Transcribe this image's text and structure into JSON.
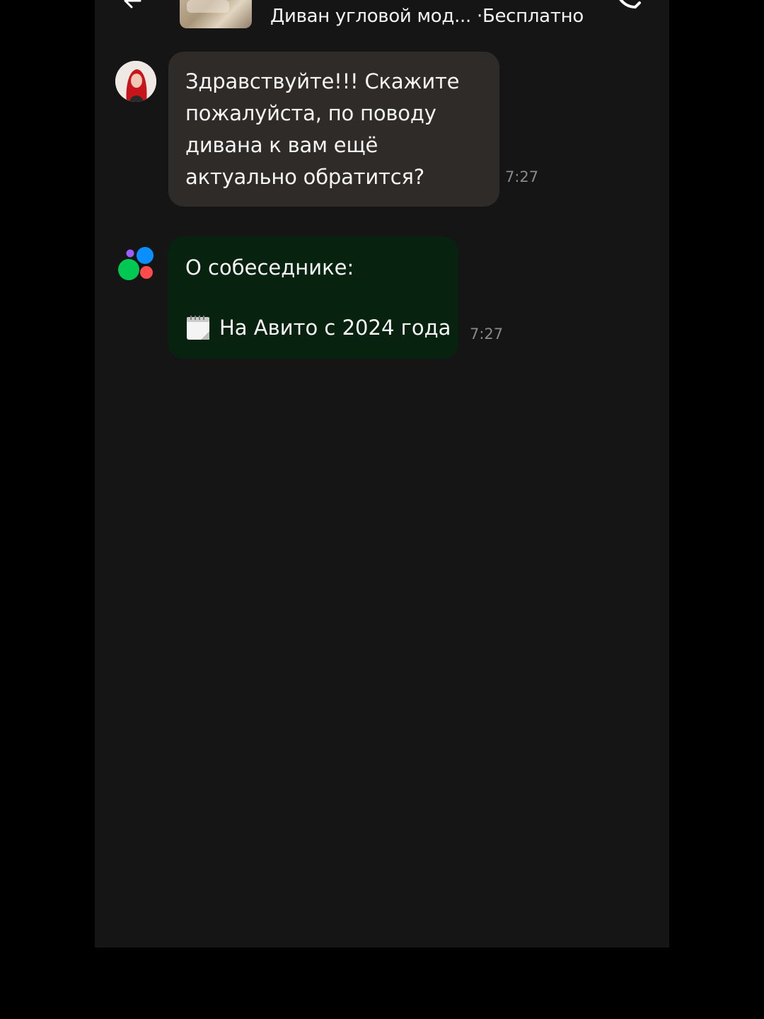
{
  "header": {
    "seller_name": "",
    "listing_title": "Диван угловой мод...",
    "separator": "·",
    "price": "Бесплатно",
    "icons": {
      "back": "arrow-left-icon",
      "phone": "phone-icon"
    }
  },
  "messages": [
    {
      "sender": "user",
      "text": "Здравствуйте!!! Скажите пожалуйста, по поводу дивана к вам ещё актуально обратится?",
      "time": "7:27"
    },
    {
      "sender": "avito",
      "title": "О собеседнике:",
      "row_emoji": "calendar-icon",
      "row_text": "На Авито с 2024 года",
      "time": "7:27"
    }
  ],
  "colors": {
    "screen_bg": "#151515",
    "incoming_bubble": "#2e2b28",
    "system_bubble": "#07230f",
    "time_text": "#8a8a8a",
    "avito_green": "#00c853",
    "avito_blue": "#0a8fff",
    "avito_red": "#ff4b4b",
    "avito_purple": "#9c5cff"
  }
}
